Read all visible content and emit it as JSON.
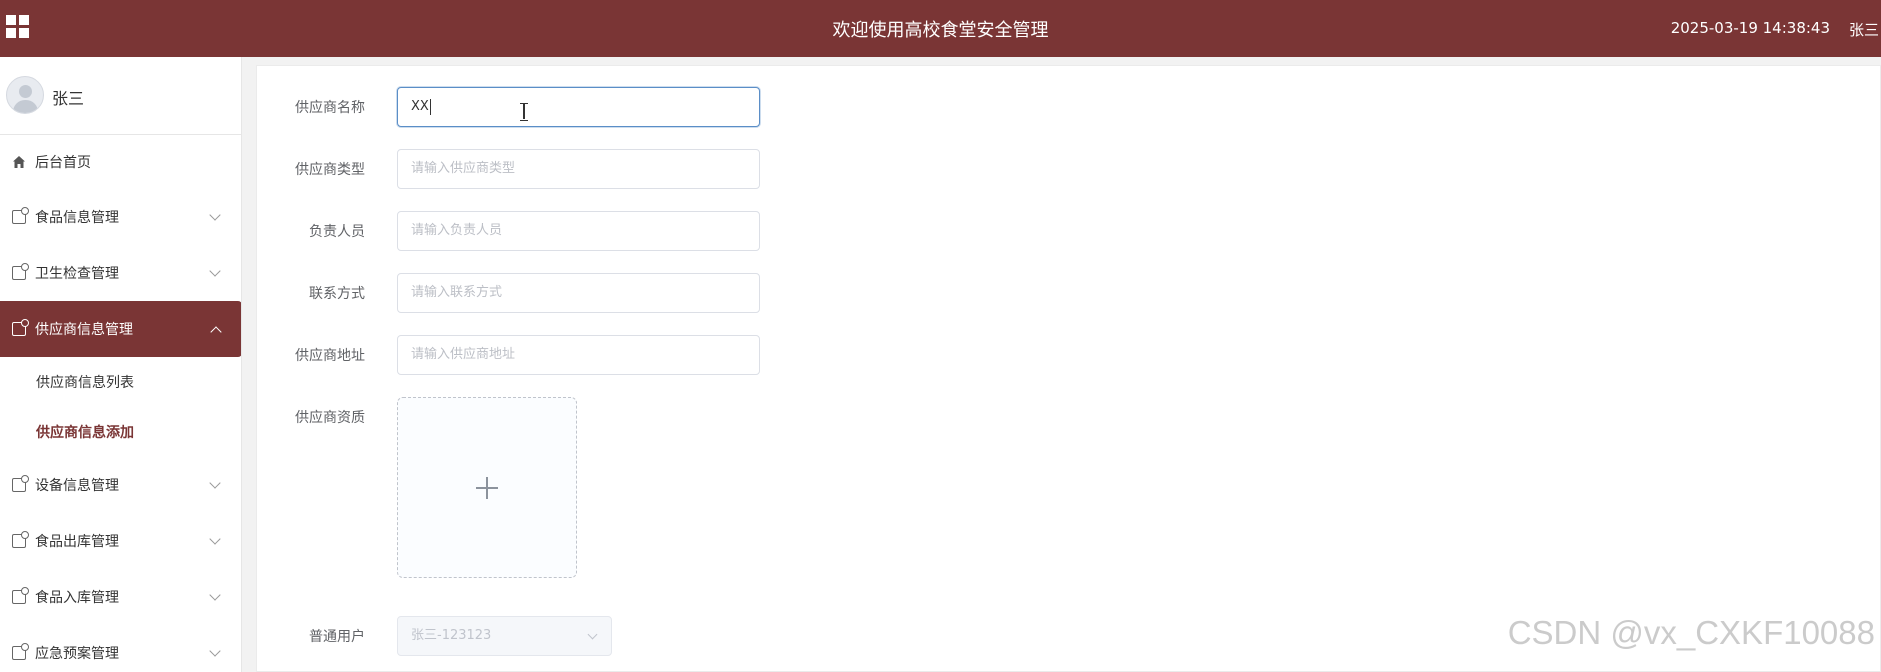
{
  "header": {
    "title": "欢迎使用高校食堂安全管理",
    "datetime": "2025-03-19 14:38:43",
    "user": "张三",
    "menu_icon": "grid-icon",
    "bg_color": "#7a3535"
  },
  "sidebar": {
    "profile_name": "张三",
    "items": [
      {
        "label": "后台首页",
        "icon": "home-icon"
      },
      {
        "label": "食品信息管理",
        "icon": "document-icon"
      },
      {
        "label": "卫生检查管理",
        "icon": "document-icon"
      },
      {
        "label": "供应商信息管理",
        "icon": "document-icon",
        "expanded": true
      },
      {
        "label": "设备信息管理",
        "icon": "document-icon"
      },
      {
        "label": "食品出库管理",
        "icon": "document-icon"
      },
      {
        "label": "食品入库管理",
        "icon": "document-icon"
      },
      {
        "label": "应急预案管理",
        "icon": "document-icon"
      }
    ],
    "sub_items": [
      {
        "label": "供应商信息列表"
      },
      {
        "label": "供应商信息添加",
        "current": true
      }
    ]
  },
  "form": {
    "name_label": "供应商名称",
    "name_value": "XX",
    "type_label": "供应商类型",
    "type_placeholder": "请输入供应商类型",
    "person_label": "负责人员",
    "person_placeholder": "请输入负责人员",
    "contact_label": "联系方式",
    "contact_placeholder": "请输入联系方式",
    "address_label": "供应商地址",
    "address_placeholder": "请输入供应商地址",
    "qualification_label": "供应商资质",
    "user_label": "普通用户",
    "user_value": "张三-123123"
  },
  "watermark": "CSDN @vx_CXKF10088"
}
